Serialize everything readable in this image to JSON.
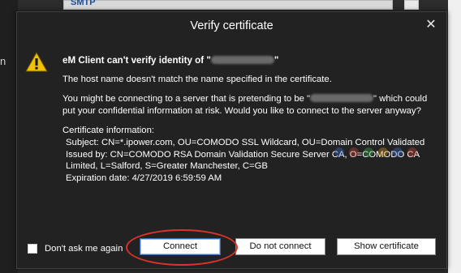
{
  "background": {
    "panel_text": "SMTP",
    "left_text": "n"
  },
  "dialog": {
    "title": "Verify certificate",
    "close_glyph": "✕",
    "heading_prefix": "eM Client can't verify identity of \"",
    "heading_suffix": "\"",
    "line1": "The host name doesn't match the name specified in the certificate.",
    "line2_prefix": "You might be connecting to a server that is pretending to be \"",
    "line2_suffix": "\" which could put your confidential information at risk. Would you like to connect to the server anyway?",
    "cert_header": "Certificate information:",
    "cert_subject": "Subject: CN=*.ipower.com, OU=COMODO SSL Wildcard, OU=Domain Control Validated",
    "cert_issued": "Issued by: CN=COMODO RSA Domain Validation Secure Server CA, O=COMODO CA Limited, L=Salford, S=Greater Manchester, C=GB",
    "cert_expiration": "Expiration date: 4/27/2019 6:59:59 AM",
    "dont_ask_label": "Don't ask me again",
    "dont_ask_checked": false,
    "buttons": {
      "connect": "Connect",
      "do_not_connect": "Do not connect",
      "show_certificate": "Show certificate"
    }
  },
  "colors": {
    "dialog_bg": "#222222",
    "highlight_ring": "#d9332c",
    "warning_yellow": "#f2c200"
  },
  "icons": {
    "warning": "warning-triangle-icon",
    "close": "close-icon"
  }
}
